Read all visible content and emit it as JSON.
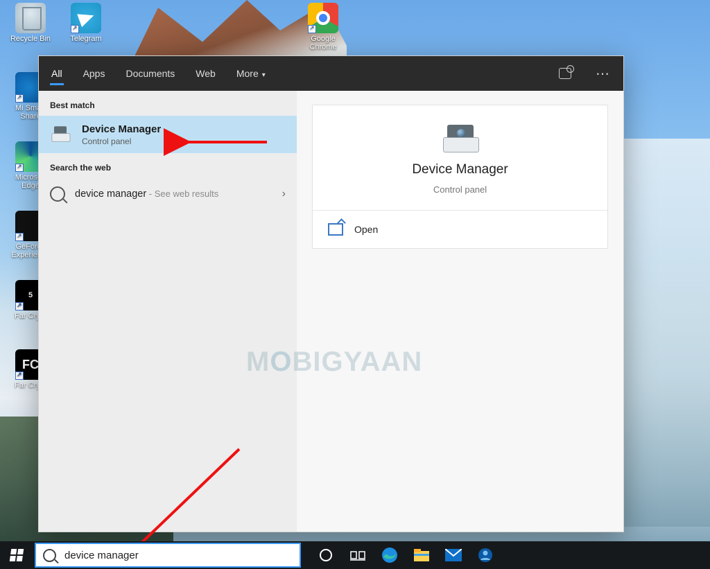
{
  "desktop": {
    "icons": [
      {
        "label": "Recycle Bin"
      },
      {
        "label": "Telegram"
      },
      {
        "label": "Google Chrome"
      },
      {
        "label": "Mi Smart Share"
      },
      {
        "label": "Microsoft Edge"
      },
      {
        "label": "GeForce Experience"
      },
      {
        "label": "Far Cry 5"
      },
      {
        "label": "Far Cry 4"
      }
    ]
  },
  "search_panel": {
    "tabs": {
      "all": "All",
      "apps": "Apps",
      "documents": "Documents",
      "web": "Web",
      "more": "More"
    },
    "left": {
      "best_match": "Best match",
      "result": {
        "title": "Device Manager",
        "subtitle": "Control panel"
      },
      "search_web_head": "Search the web",
      "web_row": {
        "query": "device manager",
        "hint": " - See web results"
      }
    },
    "right": {
      "title": "Device Manager",
      "subtitle": "Control panel",
      "action_open": "Open"
    }
  },
  "watermark": "MOBIGYAAN",
  "taskbar": {
    "search_value": "device manager"
  }
}
